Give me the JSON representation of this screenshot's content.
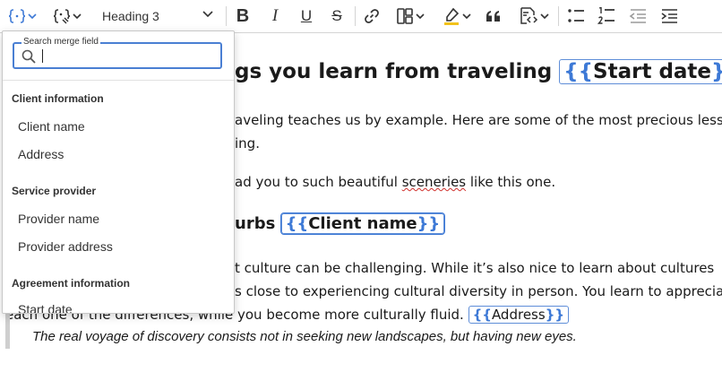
{
  "toolbar": {
    "icons": [
      "merge-field-icon",
      "merge-field-tools-icon",
      "bold-icon",
      "italic-icon",
      "underline-icon",
      "strikethrough-icon",
      "link-icon",
      "table-icon",
      "highlight-icon",
      "blockquote-icon",
      "source-editing-icon",
      "bulleted-list-icon",
      "numbered-list-icon",
      "outdent-icon",
      "indent-icon"
    ],
    "heading_select": "Heading 3",
    "bold": "B",
    "italic": "I",
    "underline": "U",
    "strike": "S",
    "colors": {
      "icon": "#333333",
      "highlight": "#f2c21b",
      "accent": "#3d79d6"
    }
  },
  "merge_panel": {
    "search_label": "Search merge field",
    "search_value": "",
    "groups": [
      {
        "title": "Client information",
        "items": [
          "Client name",
          "Address"
        ]
      },
      {
        "title": "Service provider",
        "items": [
          "Provider name",
          "Provider address"
        ]
      },
      {
        "title": "Agreement information",
        "items": [
          "Start date"
        ]
      }
    ]
  },
  "document": {
    "title_text": "gs you learn from traveling",
    "title_field": "Start date",
    "para1_line1": "aveling teaches us by example. Here are some of the most precious lessons",
    "para1_line2": "ing.",
    "para2_before": "ad you to such beautiful ",
    "para2_spell": "sceneries",
    "para2_after": " like this one.",
    "subheading_text": "urbs",
    "subheading_field": "Client name",
    "para3_line1": "t culture can be challenging. While it’s also nice to learn about cultures",
    "para3_line2": "s close to experiencing cultural diversity in person. You learn to appreciate",
    "para3_line3": "each one of the differences, while you become more culturally fluid.",
    "para3_field": "Address",
    "quote": "The real voyage of discovery consists not in seeking new landscapes, but having new eyes.",
    "field_open": "{{",
    "field_close": "}}"
  }
}
